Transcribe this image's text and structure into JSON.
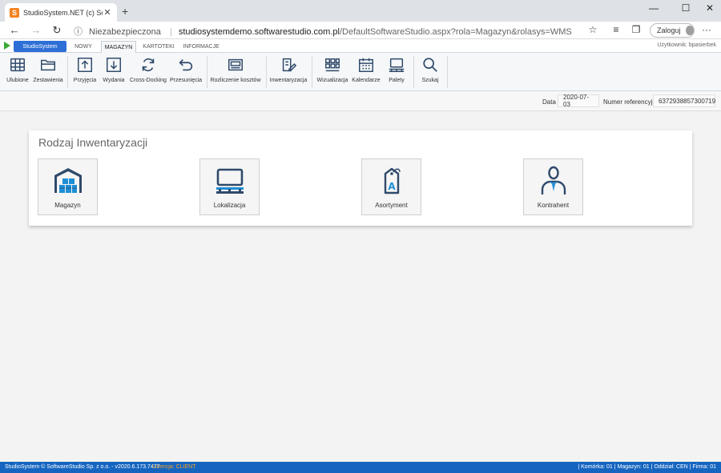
{
  "browser": {
    "tab_title": "StudioSystem.NET (c) SoftwareSt",
    "tab_close": "✕",
    "new_tab": "+",
    "security_label": "Niezabezpieczona",
    "url_domain": "studiosystemdemo.softwarestudio.com.pl",
    "url_path": "/DefaultSoftwareStudio.aspx?rola=Magazyn&rolasys=WMS",
    "login_label": "Zaloguj"
  },
  "app": {
    "brand": "StudioSystem",
    "menu_tabs": [
      "NOWY",
      "MAGAZYN",
      "KARTOTEKI",
      "INFORMACJE"
    ],
    "active_tab": "MAGAZYN",
    "user": "Użytkownik: bpasierbek"
  },
  "ribbon": {
    "buttons": [
      {
        "label": "Ulubione",
        "icon": "favorites-grid-icon"
      },
      {
        "label": "Zestawienia",
        "icon": "folder-icon"
      },
      {
        "label": "Przyjęcia",
        "icon": "receipt-arrow-up-icon"
      },
      {
        "label": "Wydania",
        "icon": "issue-arrow-down-icon"
      },
      {
        "label": "Cross-Docking",
        "icon": "refresh-cycle-icon"
      },
      {
        "label": "Przesunięcia",
        "icon": "undo-arrow-icon"
      },
      {
        "label": "Rozliczenie kosztów",
        "icon": "cost-settlement-icon"
      },
      {
        "label": "Inwentaryzacja",
        "icon": "inventory-edit-icon"
      },
      {
        "label": "Wizualizacja",
        "icon": "visualization-icon"
      },
      {
        "label": "Kalendarze",
        "icon": "calendar-icon"
      },
      {
        "label": "Palety",
        "icon": "pallet-icon"
      },
      {
        "label": "Szukaj",
        "icon": "search-icon"
      }
    ]
  },
  "info": {
    "date_label": "Data",
    "date_value": "2020-07-03",
    "ref_label": "Numer referencyjny",
    "ref_value": "6372938857300719"
  },
  "panel": {
    "title": "Rodzaj Inwentaryzacji",
    "tiles": [
      {
        "label": "Magazyn",
        "icon": "warehouse-icon"
      },
      {
        "label": "Lokalizacja",
        "icon": "location-rack-icon"
      },
      {
        "label": "Asortyment",
        "icon": "product-tag-icon"
      },
      {
        "label": "Kontrahent",
        "icon": "contractor-person-icon"
      }
    ]
  },
  "status": {
    "copyright": "StudioSystem © SoftwareStudio Sp. z o.o. - v2020.6.173.7477",
    "license": "Licencja: CLIENT",
    "context": "| Komórka: 01 | Magazyn: 01 | Oddział: CEN | Firma: 01"
  },
  "colors": {
    "accent_blue": "#2d6fd6",
    "icon_navy": "#2f4a6a",
    "statusbar": "#1565c0",
    "license_orange": "#f6a623"
  }
}
